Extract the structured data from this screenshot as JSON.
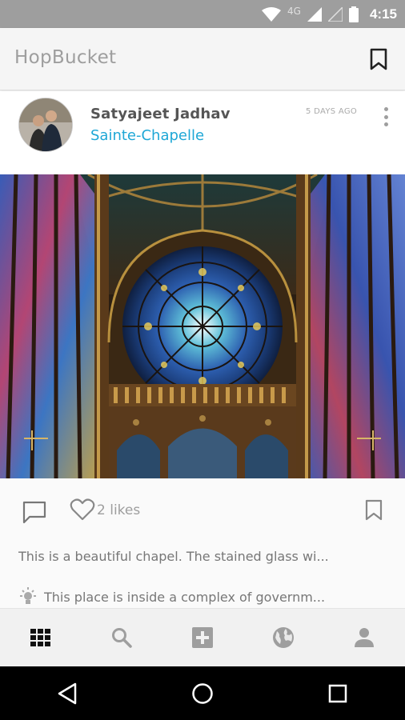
{
  "status_bar": {
    "time": "4:15",
    "network": "4G"
  },
  "app": {
    "title": "HopBucket"
  },
  "post": {
    "author": "Satyajeet Jadhav",
    "place": "Sainte-Chapelle",
    "time_ago": "5 DAYS AGO",
    "likes": "2 likes",
    "caption": "This is a beautiful chapel. The stained glass wi...",
    "tip": "This place is inside a complex of governm..."
  },
  "icons": {
    "app_bookmark": "bookmark-outline-icon",
    "more": "more-vert-icon",
    "comment": "comment-icon",
    "like": "heart-outline-icon",
    "save": "bookmark-outline-icon",
    "tip": "lightbulb-icon",
    "nav": [
      "grid-icon",
      "search-icon",
      "add-box-icon",
      "globe-icon",
      "person-icon"
    ]
  },
  "colors": {
    "accent": "#1ea7d6",
    "muted": "#9e9e9e",
    "status_bar": "#9e9e9e"
  }
}
